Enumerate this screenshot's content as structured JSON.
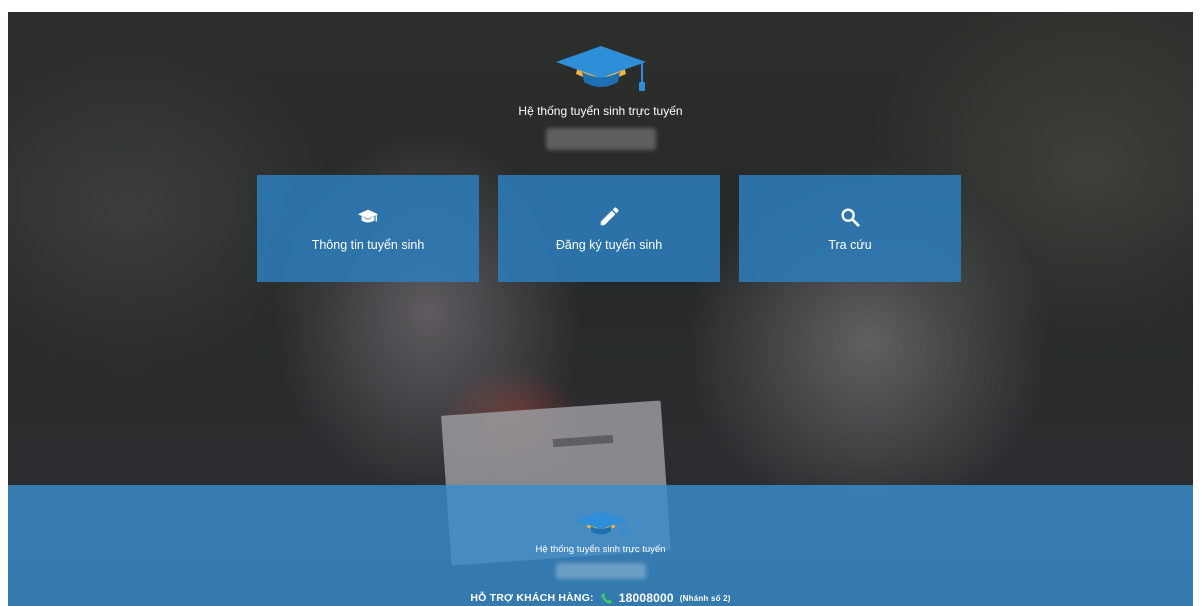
{
  "header": {
    "title": "Hệ thống tuyển sinh trực tuyến"
  },
  "tiles": [
    {
      "label": "Thông tin tuyển sinh",
      "icon": "graduation-cap-icon"
    },
    {
      "label": "Đăng ký tuyển sinh",
      "icon": "pencil-icon"
    },
    {
      "label": "Tra cứu",
      "icon": "search-icon"
    }
  ],
  "footer": {
    "title": "Hệ thống tuyển sinh trực tuyến",
    "support_label": "HỖ TRỢ KHÁCH HÀNG:",
    "phone": "18008000",
    "phone_ext": "(Nhánh số 2)"
  },
  "colors": {
    "tile": "#2c7cb9",
    "footer": "#388ccd",
    "cap": "#2e8fd8",
    "cap_accent": "#f5b53d",
    "phone_icon": "#3ccf5a"
  }
}
